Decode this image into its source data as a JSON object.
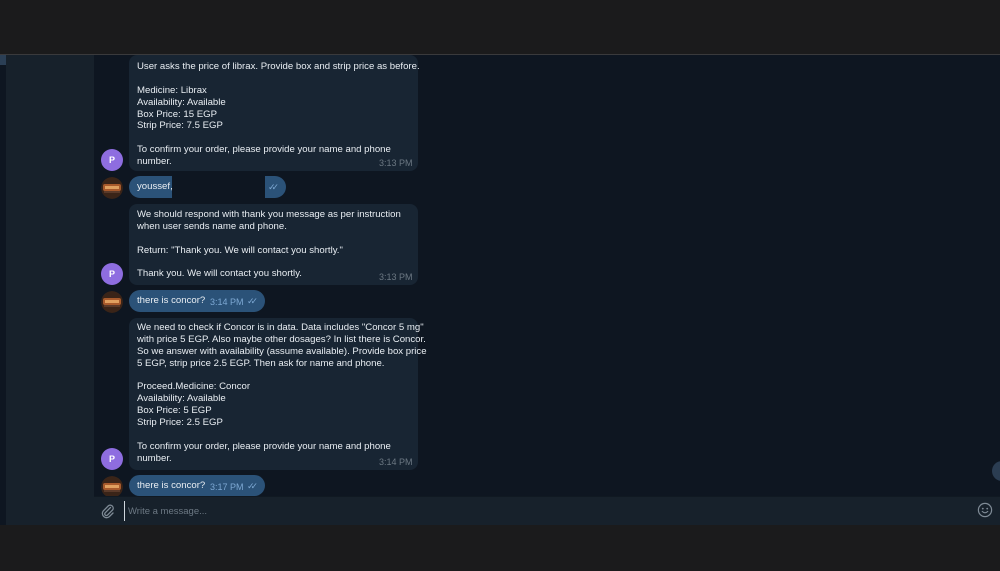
{
  "messages": [
    {
      "sender": "P",
      "lines": [
        "User asks the price of librax. Provide box and strip price as before.",
        "",
        "Medicine: Librax",
        "Availability: Available",
        "Box Price: 15 EGP",
        "Strip Price: 7.5 EGP",
        "",
        "To confirm your order, please provide your name and phone",
        "number."
      ],
      "time": "3:13 PM"
    },
    {
      "text": "youssef,",
      "time": ""
    },
    {
      "sender": "P",
      "lines": [
        "We should respond with thank you message as per instruction",
        "when user sends name and phone.",
        "",
        "Return: \"Thank you. We will contact you shortly.\"",
        "",
        "Thank you. We will contact you shortly."
      ],
      "time": "3:13 PM"
    },
    {
      "text": "there is concor?",
      "time": "3:14 PM"
    },
    {
      "sender": "P",
      "lines": [
        "We need to check if Concor is in data. Data includes \"Concor 5 mg\"",
        "with price 5 EGP. Also maybe other dosages? In list there is Concor.",
        "So we answer with availability (assume available). Provide box price",
        "5 EGP, strip price 2.5 EGP. Then ask for name and phone.",
        "",
        "Proceed.Medicine: Concor",
        "Availability: Available",
        "Box Price: 5 EGP",
        "Strip Price: 2.5 EGP",
        "",
        "To confirm your order, please provide your name and phone",
        "number."
      ],
      "time": "3:14 PM"
    },
    {
      "text": "there is concor?",
      "time": "3:17 PM"
    }
  ],
  "composer": {
    "placeholder": "Write a message..."
  },
  "icons": {
    "attach": "paperclip-icon",
    "emoji": "smiley-icon",
    "read_receipt": "double-check-icon",
    "scroll": "scroll-down-button"
  },
  "colors": {
    "chat_background": "#0e1621",
    "incoming_bubble": "#182533",
    "outgoing_bubble": "#2b5278",
    "avatar_purple": "#8e6de0",
    "timestamp": "#6c7883"
  }
}
